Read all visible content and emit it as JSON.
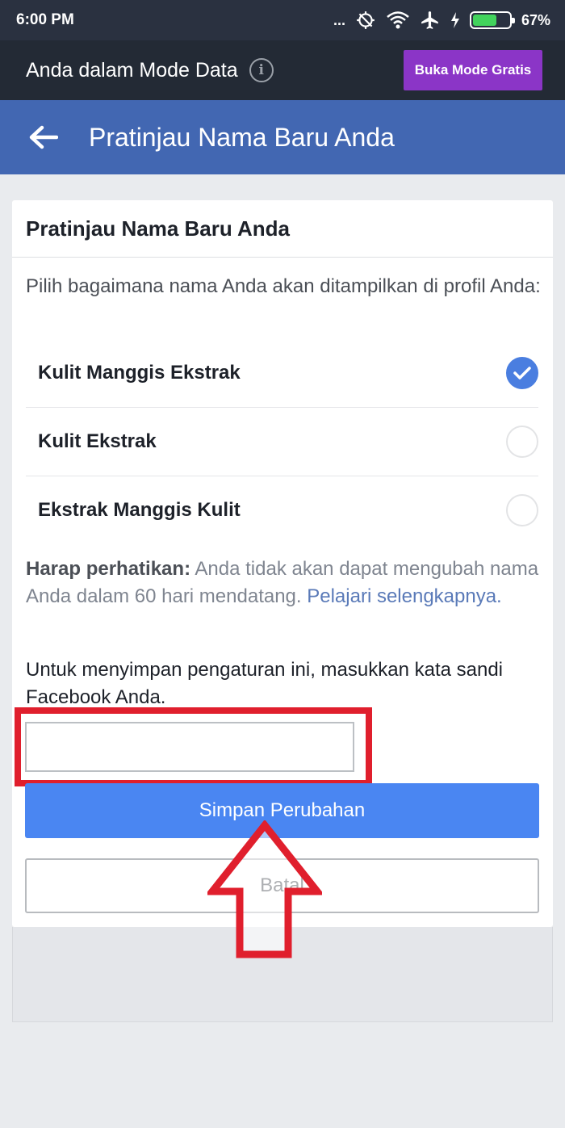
{
  "status_bar": {
    "time": "6:00 PM",
    "dots": "...",
    "battery_percent": "67%",
    "battery_level": 0.67
  },
  "data_bar": {
    "text": "Anda dalam Mode Data",
    "free_mode_button": "Buka Mode Gratis"
  },
  "header": {
    "title": "Pratinjau Nama Baru Anda"
  },
  "card": {
    "title": "Pratinjau Nama Baru Anda",
    "instruction": "Pilih bagaimana nama Anda akan ditampilkan di profil Anda:",
    "options": [
      {
        "label": "Kulit Manggis Ekstrak",
        "selected": true
      },
      {
        "label": "Kulit Ekstrak",
        "selected": false
      },
      {
        "label": "Ekstrak Manggis Kulit",
        "selected": false
      }
    ],
    "notice_bold": "Harap perhatikan:",
    "notice_text": " Anda tidak akan dapat mengubah nama Anda dalam 60 hari mendatang. ",
    "notice_link": "Pelajari selengkapnya.",
    "password_instruction": "Untuk menyimpan pengaturan ini, masukkan kata sandi Facebook Anda.",
    "password_value": "",
    "save_button": "Simpan Perubahan",
    "cancel_button": "Batal"
  },
  "colors": {
    "facebook_blue": "#4267b2",
    "button_blue": "#4a86f2",
    "highlight_red": "#e01f2d",
    "purple": "#8b35c7"
  }
}
